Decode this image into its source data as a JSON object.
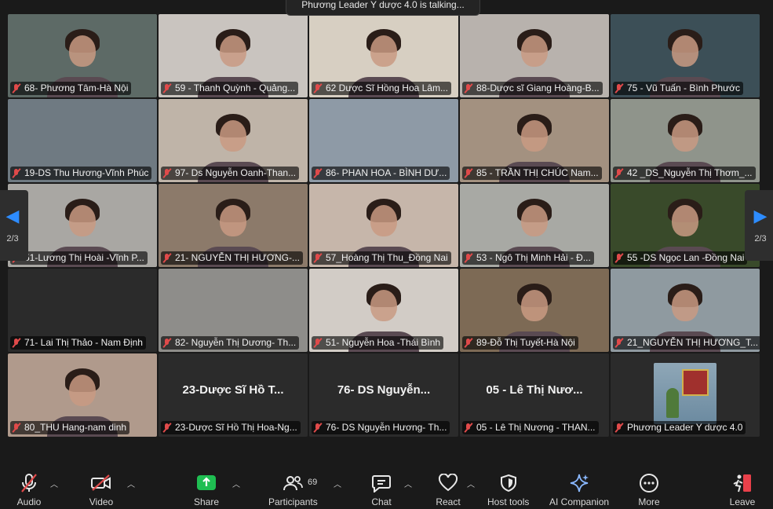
{
  "talking_banner": "Phương Leader Y dược 4.0 is talking...",
  "pagination": {
    "left_page": "2/3",
    "right_page": "2/3"
  },
  "tiles": [
    {
      "label": "68- Phương Tâm-Hà Nội",
      "bg": "#5d6a66",
      "face": true
    },
    {
      "label": "59 - Thanh Quỳnh - Quảng...",
      "bg": "#c9c4bf",
      "face": true
    },
    {
      "label": "62 Dược Sĩ Hồng Hoa Lâm...",
      "bg": "#d7cfc2",
      "face": true
    },
    {
      "label": "88-Dược sĩ Giang Hoàng-B...",
      "bg": "#b8b2ad",
      "face": true
    },
    {
      "label": "75 - Vũ Tuấn - Bình Phước",
      "bg": "#3c4f57",
      "face": true
    },
    {
      "label": "19-DS Thu Hương-Vĩnh Phúc",
      "bg": "#6f7a82",
      "face": false
    },
    {
      "label": "97- Ds Nguyễn Oanh-Than...",
      "bg": "#bfb4a8",
      "face": true
    },
    {
      "label": "86- PHAN HOA - BÌNH DƯ...",
      "bg": "#8e9aa6",
      "face": false
    },
    {
      "label": "85 - TRẦN THỊ CHÚC  Nam...",
      "bg": "#a39180",
      "face": true
    },
    {
      "label": "42 _DS_Nguyễn Thị Thơm_...",
      "bg": "#8f948b",
      "face": true
    },
    {
      "label": "51-Lương Thị Hoài -Vĩnh P...",
      "bg": "#a9a7a3",
      "face": true
    },
    {
      "label": "21- NGUYỄN THỊ HƯƠNG-...",
      "bg": "#8c7a6a",
      "face": true
    },
    {
      "label": "57_Hoàng Thị Thu_Đồng Nai",
      "bg": "#c6b6aa",
      "face": true
    },
    {
      "label": "53 - Ngô Thị Minh Hải - Đ...",
      "bg": "#a8a9a4",
      "face": true
    },
    {
      "label": "55 -DS Ngọc Lan -Đồng Nai",
      "bg": "#394a2a",
      "face": true
    },
    {
      "label": "71- Lai Thị Thảo - Nam Định",
      "bg": "#2b2b2b",
      "face": false
    },
    {
      "label": "82- Nguyễn Thị Dương- Th...",
      "bg": "#8e8d8a",
      "face": false
    },
    {
      "label": "51- Nguyễn Hoa -Thái Bình",
      "bg": "#d2ccc6",
      "face": true
    },
    {
      "label": "89-Đỗ Thị Tuyết-Hà Nội",
      "bg": "#7d6a55",
      "face": true
    },
    {
      "label": "21_NGUYỄN THỊ HƯƠNG_T...",
      "bg": "#8f9aa0",
      "face": true
    },
    {
      "label": "80_THU Hang-nam dinh",
      "bg": "#b09a8c",
      "face": true
    },
    {
      "label": "23-Dược Sĩ Hồ Thị Hoa-Ng...",
      "bg": "#2b2b2b",
      "face": false,
      "avatar_name": "23-Dược Sĩ Hồ T..."
    },
    {
      "label": "76- DS Nguyễn Hương- Th...",
      "bg": "#2b2b2b",
      "face": false,
      "avatar_name": "76- DS Nguyễn..."
    },
    {
      "label": "05 - Lê Thị Nương - THAN...",
      "bg": "#2b2b2b",
      "face": false,
      "avatar_name": "05 - Lê Thị Nươ..."
    },
    {
      "label": "Phương Leader Y dược 4.0",
      "bg": "#2b2b2b",
      "face": false,
      "avatar_pic": true
    }
  ],
  "toolbar": {
    "audio": "Audio",
    "video": "Video",
    "share": "Share",
    "participants": "Participants",
    "participants_count": "69",
    "chat": "Chat",
    "react": "React",
    "host_tools": "Host tools",
    "ai_companion": "AI Companion",
    "more": "More",
    "leave": "Leave"
  },
  "colors": {
    "accent_blue": "#2d8cff",
    "share_green": "#1fbe52",
    "mute_red": "#e04a4a",
    "leave_red": "#e8404a"
  }
}
